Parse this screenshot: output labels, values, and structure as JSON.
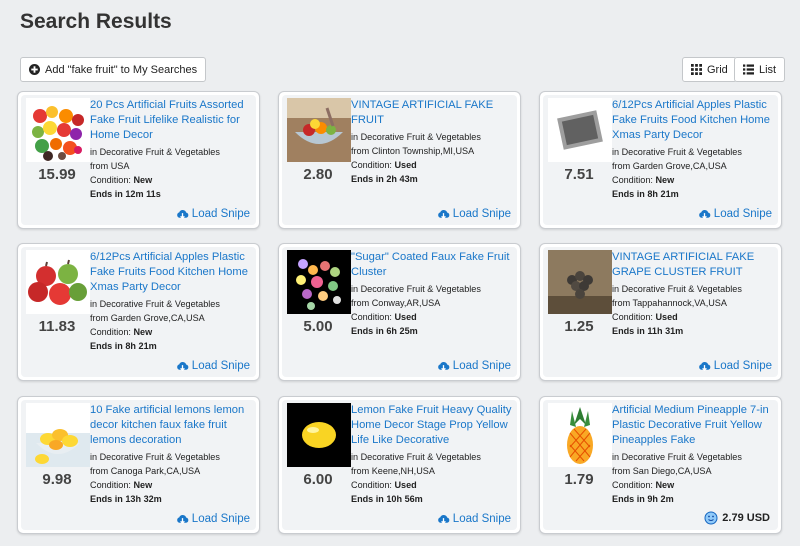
{
  "page": {
    "title": "Search Results",
    "add_search_label": "Add \"fake fruit\" to My Searches",
    "grid_label": "Grid",
    "list_label": "List"
  },
  "colors": {
    "link": "#1a77c9",
    "background": "#eceef0"
  },
  "items": [
    {
      "title": "20 Pcs Artificial Fruits Assorted Fake Fruit Lifelike Realistic for Home Decor",
      "category": "in Decorative Fruit & Vegetables",
      "location": "from USA",
      "condition_label": "Condition:",
      "condition": "New",
      "ends_label": "Ends in",
      "ends": "12m 11s",
      "price": "15.99",
      "action": "Load Snipe",
      "thumb": "assorted-fruits"
    },
    {
      "title": "VINTAGE ARTIFICIAL FAKE FRUIT",
      "category": "in Decorative Fruit & Vegetables",
      "location": "from Clinton Township,MI,USA",
      "condition_label": "Condition:",
      "condition": "Used",
      "ends_label": "Ends in",
      "ends": "2h 43m",
      "price": "2.80",
      "action": "Load Snipe",
      "thumb": "vintage-bowl"
    },
    {
      "title": "6/12Pcs Artificial Apples Plastic Fake Fruits Food Kitchen Home Xmas Party Decor",
      "category": "in Decorative Fruit & Vegetables",
      "location": "from Garden Grove,CA,USA",
      "condition_label": "Condition:",
      "condition": "New",
      "ends_label": "Ends in",
      "ends": "8h 21m",
      "price": "7.51",
      "action": "Load Snipe",
      "thumb": "placeholder"
    },
    {
      "title": "6/12Pcs Artificial Apples Plastic Fake Fruits Food Kitchen Home Xmas Party Decor",
      "category": "in Decorative Fruit & Vegetables",
      "location": "from Garden Grove,CA,USA",
      "condition_label": "Condition:",
      "condition": "New",
      "ends_label": "Ends in",
      "ends": "8h 21m",
      "price": "11.83",
      "action": "Load Snipe",
      "thumb": "apples"
    },
    {
      "title": "\"Sugar\" Coated Faux Fake Fruit Cluster",
      "category": "in Decorative Fruit & Vegetables",
      "location": "from Conway,AR,USA",
      "condition_label": "Condition:",
      "condition": "Used",
      "ends_label": "Ends in",
      "ends": "6h 25m",
      "price": "5.00",
      "action": "Load Snipe",
      "thumb": "sugar-cluster"
    },
    {
      "title": "VINTAGE ARTIFICIAL FAKE GRAPE CLUSTER FRUIT",
      "category": "in Decorative Fruit & Vegetables",
      "location": "from Tappahannock,VA,USA",
      "condition_label": "Condition:",
      "condition": "Used",
      "ends_label": "Ends in",
      "ends": "11h 31m",
      "price": "1.25",
      "action": "Load Snipe",
      "thumb": "grape-cluster"
    },
    {
      "title": "10 Fake artificial lemons lemon decor kitchen faux fake fruit lemons decoration",
      "category": "in Decorative Fruit & Vegetables",
      "location": "from Canoga Park,CA,USA",
      "condition_label": "Condition:",
      "condition": "New",
      "ends_label": "Ends in",
      "ends": "13h 32m",
      "price": "9.98",
      "action": "Load Snipe",
      "thumb": "lemons-bowl"
    },
    {
      "title": "Lemon Fake Fruit Heavy Quality Home Decor Stage Prop Yellow Life Like Decorative",
      "category": "in Decorative Fruit & Vegetables",
      "location": "from Keene,NH,USA",
      "condition_label": "Condition:",
      "condition": "Used",
      "ends_label": "Ends in",
      "ends": "10h 56m",
      "price": "6.00",
      "action": "Load Snipe",
      "thumb": "single-lemon"
    },
    {
      "title": "Artificial Medium Pineapple 7-in Plastic Decorative Fruit Yellow Pineapples Fake",
      "category": "in Decorative Fruit & Vegetables",
      "location": "from San Diego,CA,USA",
      "condition_label": "Condition:",
      "condition": "New",
      "ends_label": "Ends in",
      "ends": "9h 2m",
      "price": "1.79",
      "bid": "2.79 USD",
      "thumb": "pineapple"
    }
  ]
}
